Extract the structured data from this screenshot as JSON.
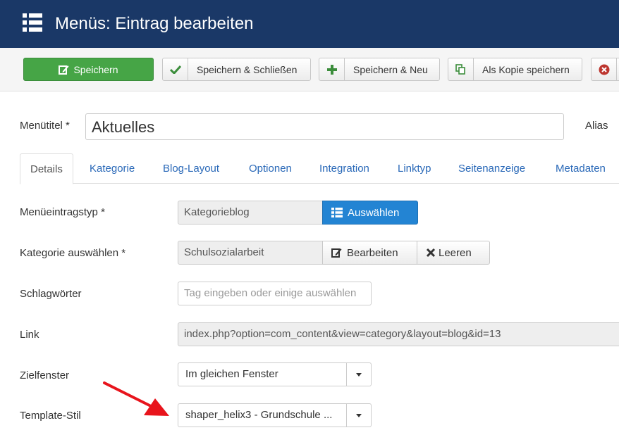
{
  "header": {
    "title": "Menüs: Eintrag bearbeiten"
  },
  "toolbar": {
    "save": "Speichern",
    "save_close": "Speichern & Schließen",
    "save_new": "Speichern & Neu",
    "save_copy": "Als Kopie speichern"
  },
  "form": {
    "menu_title_label": "Menütitel *",
    "menu_title_value": "Aktuelles",
    "alias_label": "Alias"
  },
  "tabs": [
    "Details",
    "Kategorie",
    "Blog-Layout",
    "Optionen",
    "Integration",
    "Linktyp",
    "Seitenanzeige",
    "Metadaten"
  ],
  "details": {
    "type_label": "Menüeintragstyp *",
    "type_value": "Kategorieblog",
    "select_button": "Auswählen",
    "category_label": "Kategorie auswählen *",
    "category_value": "Schulsozialarbeit",
    "edit_button": "Bearbeiten",
    "clear_button": "Leeren",
    "tags_label": "Schlagwörter",
    "tags_placeholder": "Tag eingeben oder einige auswählen",
    "link_label": "Link",
    "link_value": "index.php?option=com_content&view=category&layout=blog&id=13",
    "target_label": "Zielfenster",
    "target_value": "Im gleichen Fenster",
    "template_label": "Template-Stil",
    "template_value": "shaper_helix3 - Grundschule ..."
  },
  "colors": {
    "header": "#1a3867",
    "save_green": "#46a546",
    "select_blue": "#2384d3",
    "link_blue": "#2a69b8",
    "annotation_red": "#e8141c"
  }
}
